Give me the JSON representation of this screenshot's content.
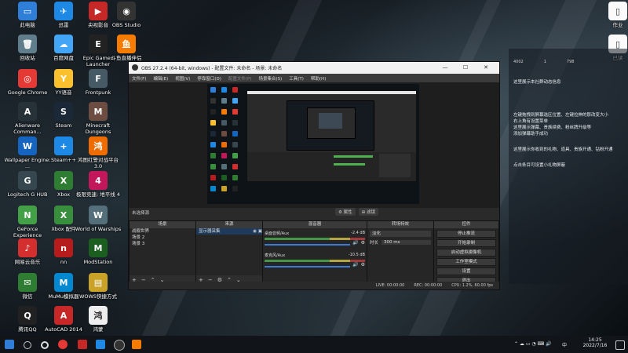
{
  "desktop_icons": [
    {
      "label": "此电脑",
      "color": "#2f7fd8",
      "glyph": "▭"
    },
    {
      "label": "迅雷",
      "color": "#1e88e5",
      "glyph": "✈"
    },
    {
      "label": "央视影音",
      "color": "#c62828",
      "glyph": "▶"
    },
    {
      "label": "OBS Studio",
      "color": "#333333",
      "glyph": "◉"
    },
    {
      "label": "回收站",
      "color": "#607d8b",
      "glyph": "🗑"
    },
    {
      "label": "百度网盘",
      "color": "#42a5f5",
      "glyph": "☁"
    },
    {
      "label": "Epic Games Launcher",
      "color": "#222222",
      "glyph": "E"
    },
    {
      "label": "斗鱼直播伴侣",
      "color": "#f57c00",
      "glyph": "鱼"
    },
    {
      "label": "Google Chrome",
      "color": "#e53935",
      "glyph": "◎"
    },
    {
      "label": "YY语音",
      "color": "#fbc02d",
      "glyph": "Y"
    },
    {
      "label": "Frontpunk",
      "color": "#455a64",
      "glyph": "F"
    },
    {
      "label": "Alienware Comman...",
      "color": "#263238",
      "glyph": "A"
    },
    {
      "label": "Steam",
      "color": "#1b2838",
      "glyph": "S"
    },
    {
      "label": "Minecraft Dungeons",
      "color": "#6d4c41",
      "glyph": "M"
    },
    {
      "label": "Wallpaper Engine: ...",
      "color": "#1565c0",
      "glyph": "W"
    },
    {
      "label": "Steam++",
      "color": "#1e88e5",
      "glyph": "+"
    },
    {
      "label": "鸿图红警对战平台3.0",
      "color": "#ef6c00",
      "glyph": "鸿"
    },
    {
      "label": "Logitech G HUB",
      "color": "#37474f",
      "glyph": "G"
    },
    {
      "label": "Xbox",
      "color": "#2e7d32",
      "glyph": "X"
    },
    {
      "label": "极限竞速: 地平线 4",
      "color": "#c2185b",
      "glyph": "4"
    },
    {
      "label": "GeForce Experience",
      "color": "#43a047",
      "glyph": "N"
    },
    {
      "label": "Xbox 配件",
      "color": "#388e3c",
      "glyph": "X"
    },
    {
      "label": "World of Warships",
      "color": "#546e7a",
      "glyph": "W"
    },
    {
      "label": "网易云音乐",
      "color": "#d32f2f",
      "glyph": "♪"
    },
    {
      "label": "nn",
      "color": "#b71c1c",
      "glyph": "n"
    },
    {
      "label": "ModStation",
      "color": "#1b5e20",
      "glyph": "M"
    },
    {
      "label": "微信",
      "color": "#2e7d32",
      "glyph": "✉"
    },
    {
      "label": "MuMu模拟器",
      "color": "#0288d1",
      "glyph": "M"
    },
    {
      "label": "WOWS快捷方式",
      "color": "#c9a227",
      "glyph": "▤"
    },
    {
      "label": "腾讯QQ",
      "color": "#212121",
      "glyph": "Q"
    },
    {
      "label": "AutoCAD 2014",
      "color": "#c62828",
      "glyph": "A"
    },
    {
      "label": "鸿蒙",
      "color": "#eeeeee",
      "glyph": "鸿"
    },
    {
      "label": "作业",
      "color": "#fafafa",
      "glyph": "▯"
    },
    {
      "label": "已读",
      "color": "#fafafa",
      "glyph": "▯"
    }
  ],
  "side_panel": {
    "stats": [
      "4002",
      "1",
      "798"
    ],
    "lines": [
      "这里展示本社群动态信息",
      "左键拖拽到屏幕选区位置、左键拉伸的那改变大小",
      "右上角有设置菜单",
      "这里展示弹幕、贵族续费、粉丝牌升级等",
      "添加弹幕助手成功",
      "这里展示你收到的礼物、道具、贵族开通、钻粉开通",
      "点击条目可设置小礼物屏蔽"
    ]
  },
  "obs": {
    "title": "OBS 27.2.4 (64-bit, windows) - 配置文件: 未命名 - 场景: 未命名",
    "menu": [
      "文件(F)",
      "编辑(E)",
      "视图(V)",
      "停靠窗口(D)",
      "配置文件(P)",
      "场景集合(S)",
      "工具(T)",
      "帮助(H)"
    ],
    "scene_label": "未选择源",
    "tools": [
      "⚙ 属性",
      "⊞ 滤镜"
    ],
    "scenes": {
      "title": "场景",
      "items": [
        "战舰世界",
        "场景 2",
        "场景 3"
      ]
    },
    "sources": {
      "title": "来源",
      "items": [
        "显示器采集"
      ]
    },
    "mixer": {
      "title": "混音器",
      "channels": [
        {
          "name": "桌面音频/Aux",
          "db": "-2.4 dB"
        },
        {
          "name": "麦克风/Aux",
          "db": "-10.5 dB"
        }
      ]
    },
    "transitions": {
      "title": "转场特效",
      "type": "淡化",
      "duration_label": "时长",
      "duration": "300 ms"
    },
    "controls": {
      "title": "控件",
      "buttons": [
        "停止推流",
        "开始录制",
        "启动虚拟摄像机",
        "工作室模式",
        "设置",
        "退出"
      ]
    },
    "status": {
      "live": "LIVE: 00:00:00",
      "rec": "REC: 00:00:00",
      "cpu": "CPU: 1.2%, 60.00 fps"
    }
  },
  "taskbar": {
    "time": "14:25",
    "date": "2022/7/16",
    "lang": "中"
  }
}
